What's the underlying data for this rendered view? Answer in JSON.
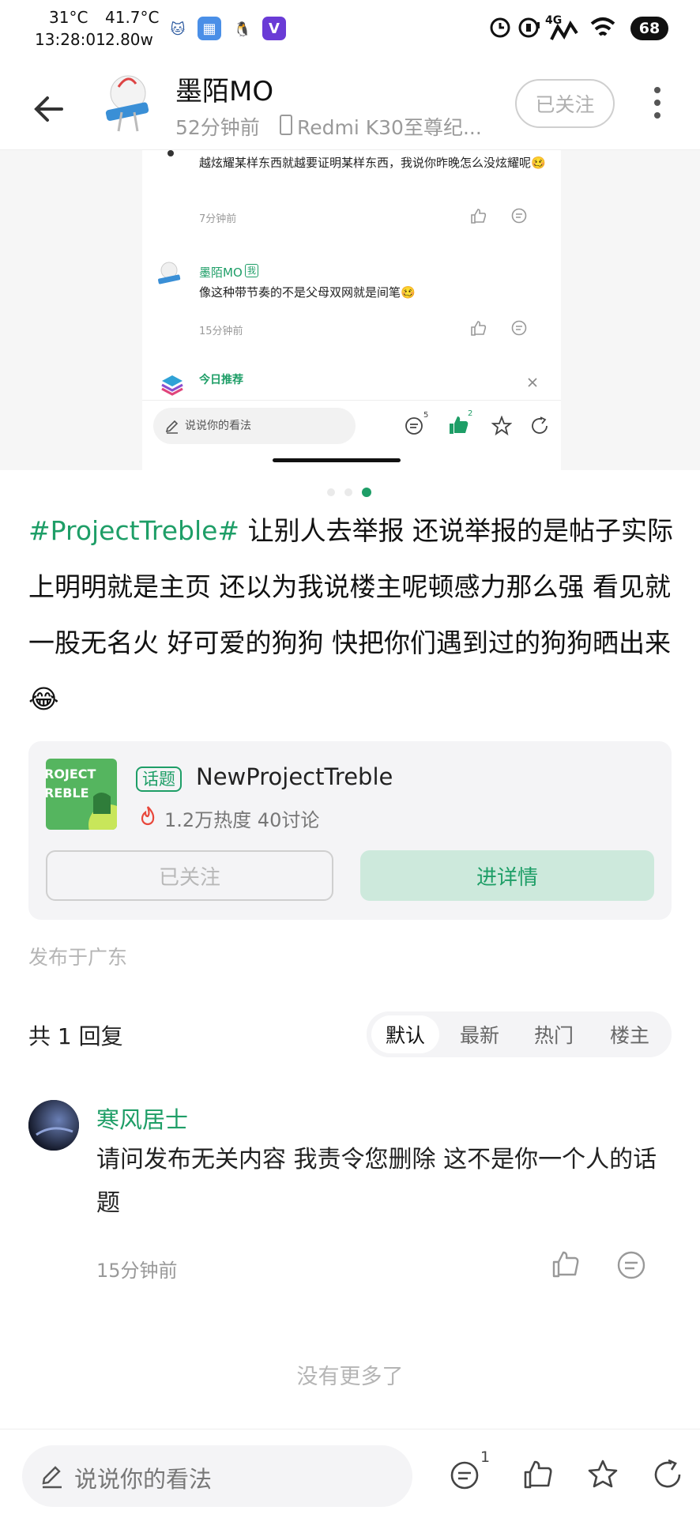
{
  "status_bar": {
    "temperature": "31°C",
    "time": "13:28:01",
    "cpu_temp": "41.7°C",
    "power": "2.80w",
    "network": "4G",
    "battery": "68"
  },
  "header": {
    "author_name": "墨陌MO",
    "post_time": "52分钟前",
    "device": "Redmi K30至尊纪...",
    "follow_label": "已关注"
  },
  "screenshot": {
    "comments": [
      {
        "text": "越炫耀某样东西就越要证明某样东西，我说你昨晚怎么没炫耀呢🥴",
        "time": "7分钟前"
      },
      {
        "name": "墨陌MO",
        "badge": "我",
        "text": "像这种带节奏的不是父母双网就是间笔🥴",
        "time": "15分钟前"
      }
    ],
    "recommend_label": "今日推荐",
    "input_placeholder": "说说你的看法",
    "comment_count": "5",
    "like_count": "2"
  },
  "post": {
    "hashtag": "#ProjectTreble#",
    "body": " 让别人去举报 还说举报的是帖子实际上明明就是主页 还以为我说楼主呢顿感力那么强 看见就一股无名火 好可爱的狗狗 快把你们遇到过的狗狗晒出来😂"
  },
  "topic": {
    "thumb_text": "ROJECT\nREBLE",
    "tag": "话题",
    "name": "NewProjectTreble",
    "stats": "1.2万热度 40讨论",
    "follow_label": "已关注",
    "details_label": "进详情"
  },
  "location": "发布于广东",
  "replies": {
    "count_label": "共 1 回复",
    "sort_tabs": [
      "默认",
      "最新",
      "热门",
      "楼主"
    ],
    "active_tab": "默认",
    "items": [
      {
        "name": "寒风居士",
        "text": "请问发布无关内容 我责令您删除 这不是你一个人的话题",
        "time": "15分钟前"
      }
    ],
    "end_label": "没有更多了"
  },
  "bottom_bar": {
    "input_placeholder": "说说你的看法",
    "comment_count": "1"
  },
  "colors": {
    "accent": "#1e9e67",
    "accent_light": "#cde9dc"
  }
}
